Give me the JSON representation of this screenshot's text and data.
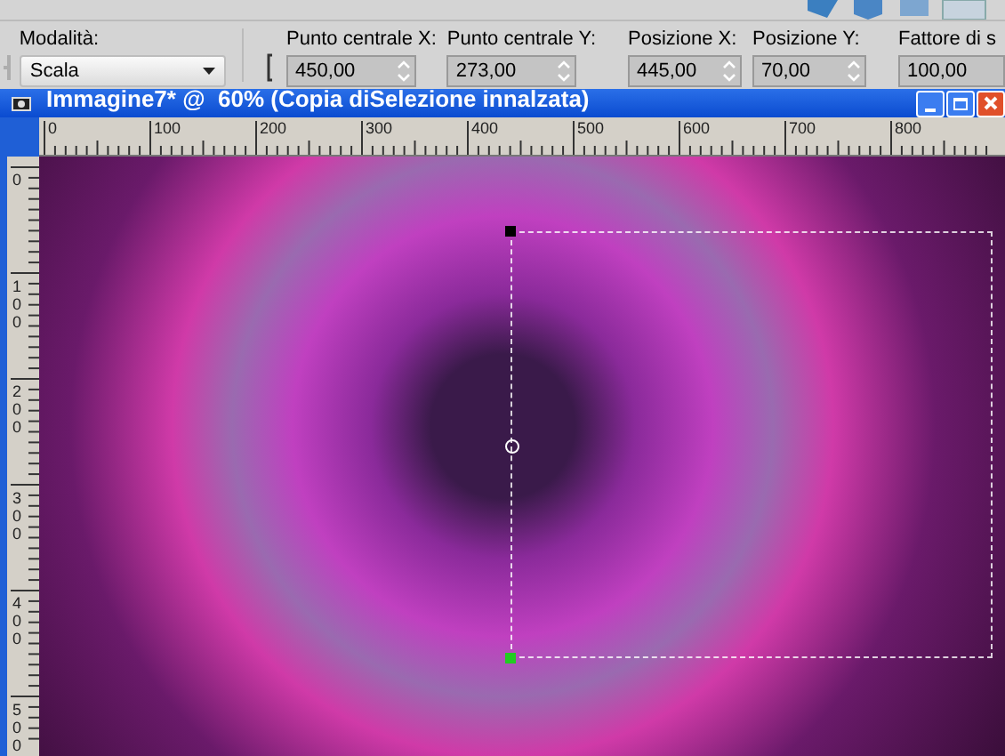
{
  "tool_options": {
    "mode": {
      "label": "Modalità:",
      "value": "Scala"
    },
    "fields": [
      {
        "label": "Punto centrale X:",
        "value": "450,00"
      },
      {
        "label": "Punto centrale Y:",
        "value": "273,00"
      },
      {
        "label": "Posizione X:",
        "value": "445,00"
      },
      {
        "label": "Posizione Y:",
        "value": "70,00"
      },
      {
        "label": "Fattore di s",
        "value": "100,00"
      }
    ]
  },
  "window": {
    "title": "Immagine7* @  60% (Copia diSelezione innalzata)"
  },
  "rulers": {
    "horizontal": [
      "0",
      "100",
      "200",
      "300",
      "400",
      "500",
      "600",
      "700",
      "800"
    ],
    "vertical": [
      "0",
      "100",
      "200",
      "300",
      "400",
      "500"
    ]
  }
}
